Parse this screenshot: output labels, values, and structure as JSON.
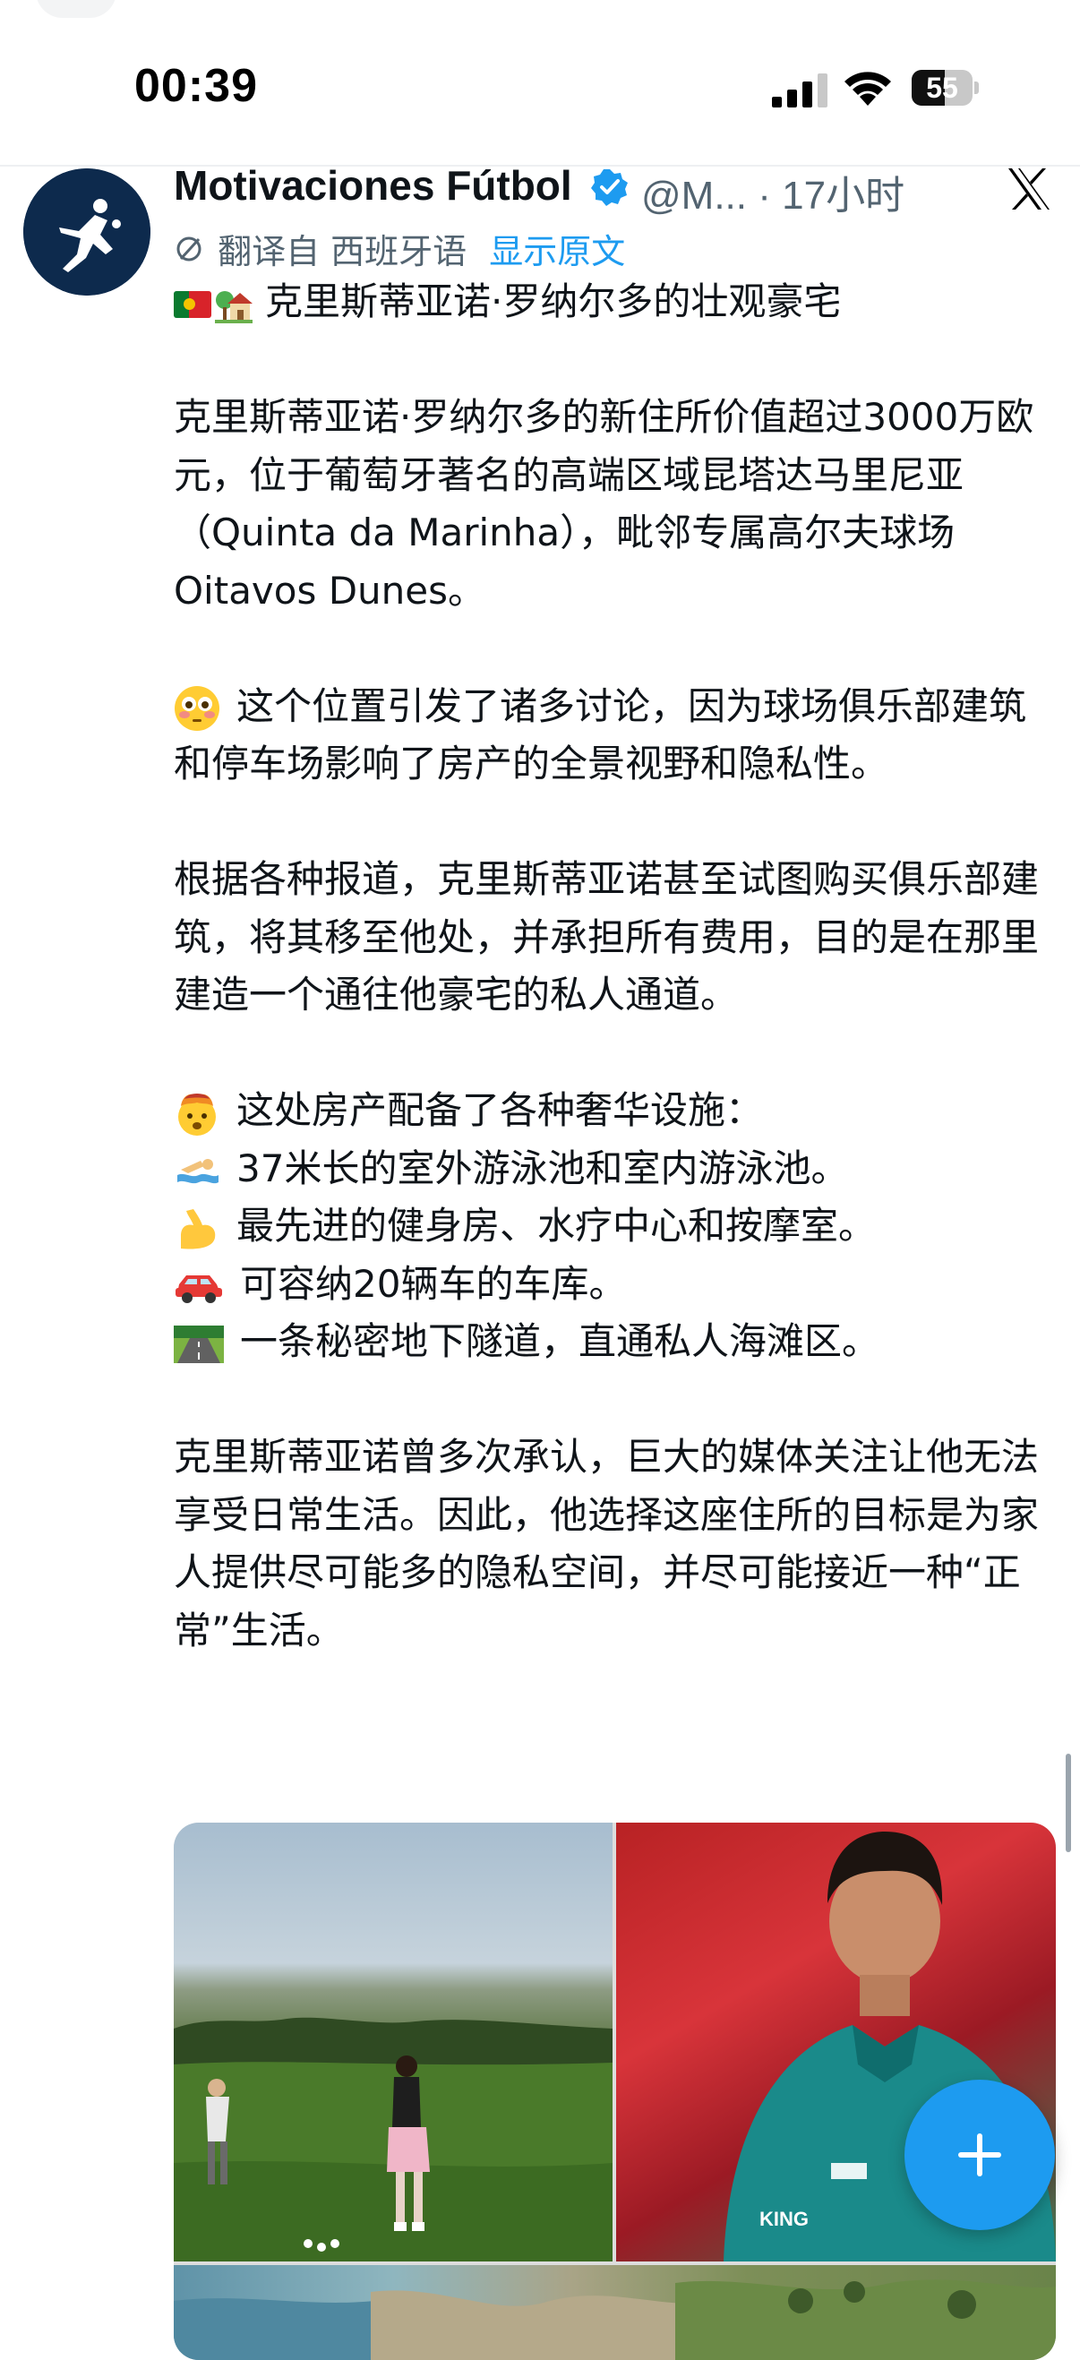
{
  "status_bar": {
    "time": "00:39",
    "battery_level": "55",
    "icons": [
      "cellular-signal-icon",
      "wifi-icon",
      "battery-icon"
    ]
  },
  "tweet": {
    "author_name": "Motivaciones Fútbol",
    "handle": "@M...",
    "separator": "·",
    "timestamp": "17小时",
    "verified": true,
    "translation_label": "翻译自 西班牙语",
    "show_original_label": "显示原文",
    "headline": "克里斯蒂亚诺·罗纳尔多的壮观豪宅",
    "paragraph_1": "克里斯蒂亚诺·罗纳尔多的新住所价值超过3000万欧元，位于葡萄牙著名的高端区域昆塔达马里尼亚（Quinta da Marinha），毗邻专属高尔夫球场Oitavos Dunes。",
    "paragraph_2": "这个位置引发了诸多讨论，因为球场俱乐部建筑和停车场影响了房产的全景视野和隐私性。",
    "paragraph_3": "根据各种报道，克里斯蒂亚诺甚至试图购买俱乐部建筑，将其移至他处，并承担所有费用，目的是在那里建造一个通往他豪宅的私人通道。",
    "amenities_intro": "这处房产配备了各种奢华设施：",
    "amenities": [
      {
        "icon": "swimmer-icon",
        "text": "37米长的室外游泳池和室内游泳池。"
      },
      {
        "icon": "flexed-bicep-icon",
        "text": "最先进的健身房、水疗中心和按摩室。"
      },
      {
        "icon": "car-icon",
        "text": "可容纳20辆车的车库。"
      },
      {
        "icon": "motorway-icon",
        "text": "一条秘密地下隧道，直通私人海滩区。"
      }
    ],
    "paragraph_4": "克里斯蒂亚诺曾多次承认，巨大的媒体关注让他无法享受日常生活。因此，他选择这座住所的目标是为家人提供尽可能多的隐私空间，并尽可能接近一种“正常”生活。"
  },
  "media": {
    "photos": [
      "golf-course-photo",
      "portrait-photo",
      "coastline-photo"
    ],
    "jersey_text": "KING"
  },
  "colors": {
    "accent": "#1d9bf0",
    "text_primary": "#0f1419",
    "text_secondary": "#536471"
  },
  "fab": {
    "icon": "plus-icon"
  }
}
